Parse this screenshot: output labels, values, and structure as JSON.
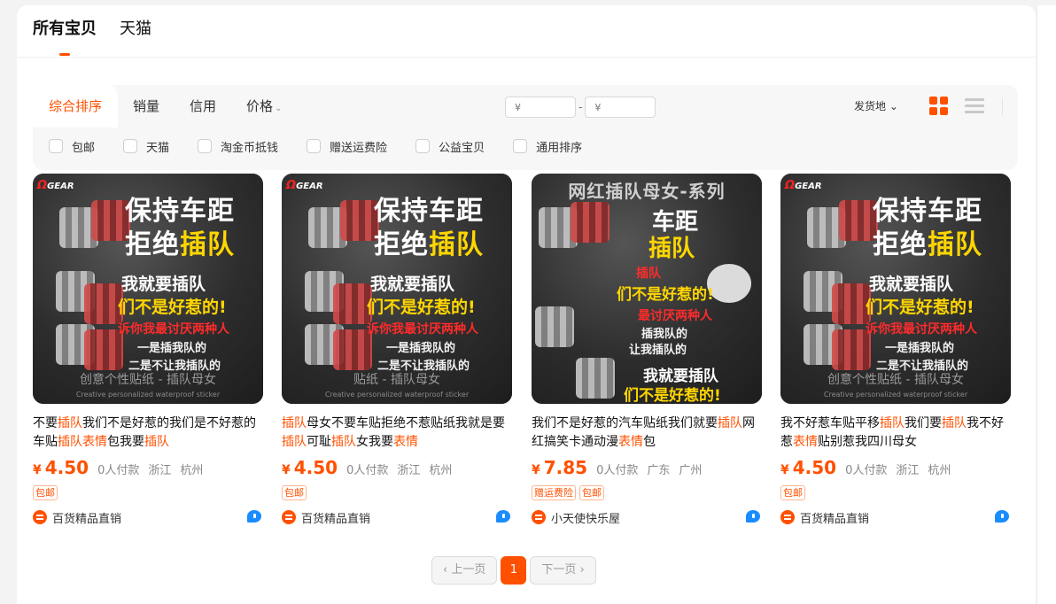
{
  "tabs": [
    {
      "label": "所有宝贝"
    },
    {
      "label": "天猫"
    }
  ],
  "sort": {
    "items": [
      {
        "label": "综合排序"
      },
      {
        "label": "销量"
      },
      {
        "label": "信用"
      },
      {
        "label": "价格"
      }
    ],
    "price_min_placeholder": "¥",
    "price_max_placeholder": "¥",
    "price_dash": "-",
    "ship_from": "发货地",
    "ship_caret": "⌄"
  },
  "filters": [
    {
      "label": "包邮"
    },
    {
      "label": "天猫"
    },
    {
      "label": "淘金币抵钱"
    },
    {
      "label": "赠送运费险"
    },
    {
      "label": "公益宝贝"
    },
    {
      "label": "通用排序"
    }
  ],
  "products": [
    {
      "title_parts": [
        {
          "text": "不要",
          "hl": false
        },
        {
          "text": "插队",
          "hl": true
        },
        {
          "text": "我们不是好惹的我们是不好惹的车贴",
          "hl": false
        },
        {
          "text": "插队表情",
          "hl": true
        },
        {
          "text": "包我要",
          "hl": false
        },
        {
          "text": "插队",
          "hl": true
        }
      ],
      "currency": "¥",
      "price": "4.50",
      "sales": "0人付款",
      "province": "浙江",
      "city": "杭州",
      "tags": [
        "包邮"
      ],
      "shop": "百货精品直销",
      "image": {
        "brand": "GEAR",
        "headline_1": "保持车距",
        "headline_2a": "拒绝",
        "headline_2b": "插队",
        "line_a": "我就要插队",
        "line_b": "们不是好惹的!",
        "line_c": "诉你我最讨厌两种人",
        "line_d": "一是插我队的",
        "line_e": "二是不让我插队的",
        "footer": "创意个性贴纸 - 插队母女",
        "footer_en": "Creative personalized waterproof sticker"
      }
    },
    {
      "title_parts": [
        {
          "text": "插队",
          "hl": true
        },
        {
          "text": "母女不要车贴拒绝不惹贴纸我就是要",
          "hl": false
        },
        {
          "text": "插队",
          "hl": true
        },
        {
          "text": "可耻",
          "hl": false
        },
        {
          "text": "插队",
          "hl": true
        },
        {
          "text": "女我要",
          "hl": false
        },
        {
          "text": "表情",
          "hl": true
        }
      ],
      "currency": "¥",
      "price": "4.50",
      "sales": "0人付款",
      "province": "浙江",
      "city": "杭州",
      "tags": [
        "包邮"
      ],
      "shop": "百货精品直销",
      "image": {
        "brand": "GEAR",
        "headline_1": "保持车距",
        "headline_2a": "拒绝",
        "headline_2b": "插队",
        "line_a": "我就要插队",
        "line_b": "们不是好惹的!",
        "line_c": "诉你我最讨厌两种人",
        "line_d": "一是插我队的",
        "line_e": "二是不让我插队的",
        "footer": "贴纸 - 插队母女",
        "footer_en": "Creative personalized waterproof sticker"
      }
    },
    {
      "title_parts": [
        {
          "text": "我们不是好惹的汽车贴纸我们就要",
          "hl": false
        },
        {
          "text": "插队",
          "hl": true
        },
        {
          "text": "网红搞笑卡通动漫",
          "hl": false
        },
        {
          "text": "表情",
          "hl": true
        },
        {
          "text": "包",
          "hl": false
        }
      ],
      "currency": "¥",
      "price": "7.85",
      "sales": "0人付款",
      "province": "广东",
      "city": "广州",
      "tags": [
        "赠运费险",
        "包邮"
      ],
      "shop": "小天使快乐屋",
      "image": {
        "banner": "网红插队母女-系列",
        "headline_1": "车距",
        "headline_2": "插队",
        "line_a": "插队",
        "line_b": "们不是好惹的!",
        "line_c": "最讨厌两种人",
        "line_d": "插我队的",
        "line_e": "让我插队的",
        "line_f": "我就要插队",
        "line_g": "们不是好惹的!"
      }
    },
    {
      "title_parts": [
        {
          "text": "我不好惹车贴平移",
          "hl": false
        },
        {
          "text": "插队",
          "hl": true
        },
        {
          "text": "我们要",
          "hl": false
        },
        {
          "text": "插队",
          "hl": true
        },
        {
          "text": "我不好惹",
          "hl": false
        },
        {
          "text": "表情",
          "hl": true
        },
        {
          "text": "贴别惹我四川母女",
          "hl": false
        }
      ],
      "currency": "¥",
      "price": "4.50",
      "sales": "0人付款",
      "province": "浙江",
      "city": "杭州",
      "tags": [
        "包邮"
      ],
      "shop": "百货精品直销",
      "image": {
        "brand": "GEAR",
        "headline_1": "保持车距",
        "headline_2a": "拒绝",
        "headline_2b": "插队",
        "line_a": "我就要插队",
        "line_b": "们不是好惹的!",
        "line_c": "诉你我最讨厌两种人",
        "line_d": "一是插我队的",
        "line_e": "二是不让我插队的",
        "footer": "创意个性贴纸 - 插队母女",
        "footer_en": "Creative personalized waterproof sticker"
      }
    }
  ],
  "pagination": {
    "prev": "‹  上一页",
    "current": "1",
    "next": "下一页  ›"
  },
  "colors": {
    "accent": "#ff5000",
    "wangwang": "#1a8cff"
  }
}
